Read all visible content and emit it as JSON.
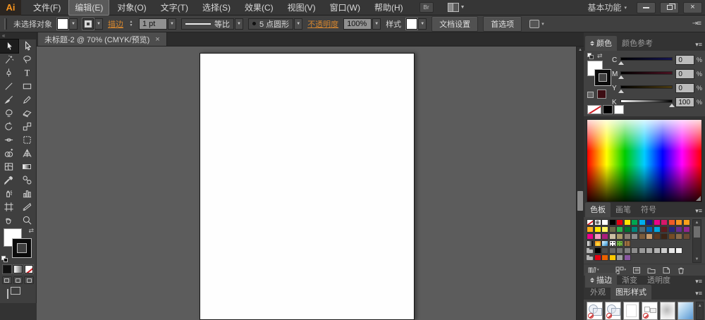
{
  "app": {
    "logo": "Ai",
    "workspace": "基本功能",
    "bridge_label": "Br"
  },
  "menu": [
    "文件(F)",
    "编辑(E)",
    "对象(O)",
    "文字(T)",
    "选择(S)",
    "效果(C)",
    "视图(V)",
    "窗口(W)",
    "帮助(H)"
  ],
  "window_controls": {
    "close": "×"
  },
  "options_bar": {
    "status": "未选择对象",
    "stroke_link": "描边",
    "stroke_weight": "1 pt",
    "profile": "等比",
    "brush": "5 点圆形",
    "opacity_link": "不透明度",
    "opacity_value": "100%",
    "style_label": "样式",
    "document_setup": "文档设置",
    "preferences": "首选项"
  },
  "document_tab": {
    "title": "未标题-2 @ 70% (CMYK/预览)",
    "close": "×"
  },
  "tools": {
    "names": [
      "selection",
      "direct-selection",
      "magic-wand",
      "lasso",
      "pen",
      "type",
      "line-segment",
      "rectangle",
      "paintbrush",
      "pencil",
      "blob-brush",
      "eraser",
      "rotate",
      "scale",
      "width",
      "free-transform",
      "shape-builder",
      "perspective-grid",
      "mesh",
      "gradient",
      "eyedropper",
      "blend",
      "symbol-sprayer",
      "column-graph",
      "artboard",
      "slice",
      "hand",
      "zoom"
    ],
    "selected": "selection"
  },
  "color_panel": {
    "tabs": [
      "颜色",
      "颜色参考"
    ],
    "sliders": [
      {
        "label": "C",
        "value": "0",
        "unit": "%"
      },
      {
        "label": "M",
        "value": "0",
        "unit": "%"
      },
      {
        "label": "Y",
        "value": "0",
        "unit": "%"
      },
      {
        "label": "K",
        "value": "100",
        "unit": "%"
      }
    ]
  },
  "swatches_panel": {
    "tabs": [
      "色板",
      "画笔",
      "符号"
    ],
    "grid": [
      [
        "none",
        "registration",
        "#ffffff",
        "#000000",
        "#e60012",
        "#ffe600",
        "#00a651",
        "#00adee",
        "#1b1781",
        "#ec008c",
        "#d6186a",
        "#ef5a28",
        "#f7941e",
        "#f9a11b"
      ],
      [
        "#fbaf17",
        "#ffe800",
        "#fff45f",
        "#6b6b4a",
        "#2bb24c",
        "#00722f",
        "#00857d",
        "#4f6a77",
        "#0066b3",
        "#00a7e1",
        "#5c1a1a",
        "#26247b",
        "#662d91",
        "#92278f"
      ],
      [
        "#ec008c",
        "#f49ac1",
        "#aa1d7c",
        "#cbbfa3",
        "#a89968",
        "#8b8075",
        "#8c8c8c",
        "#7a5b3a",
        "#c49a6c",
        "#5e3a21",
        "#3c2415",
        "#754c24",
        "#8a6b4a",
        "#6d4b35"
      ],
      [
        "grad-bw",
        "grad-sunrise",
        "grad-sky",
        "pattern-dots",
        "pattern-leaf",
        "pattern-wood",
        "empty",
        "empty",
        "empty",
        "empty",
        "empty",
        "empty",
        "empty",
        "empty"
      ],
      [
        "folder",
        "#000000",
        "#4d4d4d",
        "#666666",
        "#737373",
        "#808080",
        "#8c8c8c",
        "#999999",
        "#a6a6a6",
        "#b3b3b3",
        "#cccccc",
        "#e6e6e6",
        "#f2f2f2",
        "empty"
      ],
      [
        "folder",
        "#e60012",
        "#eb6100",
        "#fcc800",
        "#9fa0a0",
        "#8957a1",
        "empty",
        "empty",
        "empty",
        "empty",
        "empty",
        "empty",
        "empty",
        "empty"
      ]
    ]
  },
  "stroke_tabs": [
    "描边",
    "渐变",
    "透明度"
  ],
  "appearance_tabs": [
    "外观",
    "图形样式"
  ],
  "graphic_styles": [
    "default",
    "default-alt",
    "plain",
    "none",
    "shadow",
    "blue-gradient"
  ],
  "colors": {
    "accent_link": "#d5862f",
    "canvas": "#5c5c5c",
    "artboard": "#fefefe"
  }
}
